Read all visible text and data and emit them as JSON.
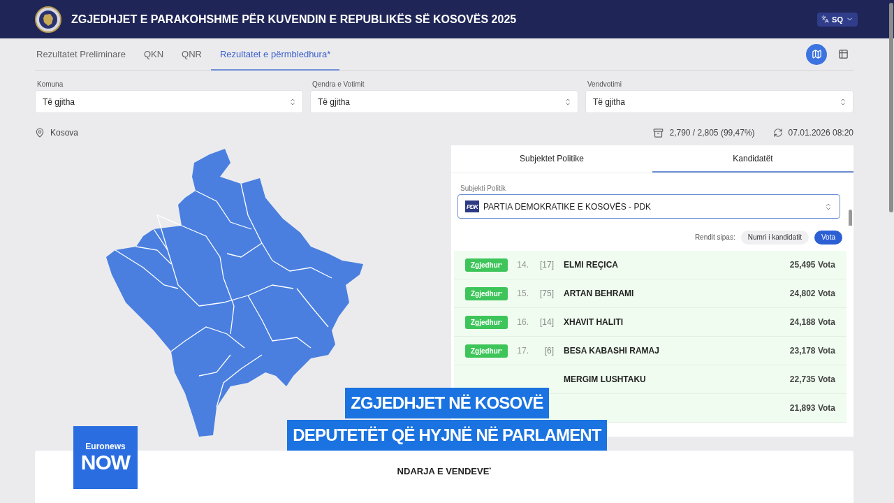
{
  "header": {
    "title": "ZGJEDHJET E PARAKOHSHME PËR KUVENDIN E REPUBLIKËS SË KOSOVËS 2025",
    "language": "SQ"
  },
  "tabs": [
    {
      "label": "Rezultatet Preliminare",
      "selected": false
    },
    {
      "label": "QKN",
      "selected": false
    },
    {
      "label": "QNR",
      "selected": false
    },
    {
      "label": "Rezultatet e përmbledhura*",
      "selected": true
    }
  ],
  "view_toggle": [
    {
      "kind": "map",
      "selected": true
    },
    {
      "kind": "table",
      "selected": false
    }
  ],
  "filters": [
    {
      "label": "Komuna",
      "value": "Të gjitha"
    },
    {
      "label": "Qendra e Votimit",
      "value": "Të gjitha"
    },
    {
      "label": "Vendvotimi",
      "value": "Të gjitha"
    }
  ],
  "location": "Kosova",
  "stations": "2,790 / 2,805 (99,47%)",
  "updated": "07.01.2026 08:20",
  "panel": {
    "tabs": [
      {
        "label": "Subjektet Politike",
        "selected": false
      },
      {
        "label": "Kandidatët",
        "selected": true
      }
    ],
    "party_label": "Subjekti Politik",
    "party_logo": "PDK",
    "party": "PARTIA DEMOKRATIKE E KOSOVËS - PDK",
    "sort_label": "Rendit sipas:",
    "sort_options": [
      {
        "label": "Numri i kandidatit",
        "selected": false
      },
      {
        "label": "Vota",
        "selected": true
      }
    ],
    "candidates": [
      {
        "status": "Zgjedhur$^{*}$",
        "rank": "14.",
        "number": "[17]",
        "name": "ELMI REÇICA",
        "votes": "25,495 Vota"
      },
      {
        "status": "Zgjedhur$^{*}$",
        "rank": "15.",
        "number": "[75]",
        "name": "ARTAN BEHRAMI",
        "votes": "24,802 Vota"
      },
      {
        "status": "Zgjedhur$^{*}$",
        "rank": "16.",
        "number": "[14]",
        "name": "XHAVIT HALITI",
        "votes": "24,188 Vota"
      },
      {
        "status": "Zgjedhur$^{*}$",
        "rank": "17.",
        "number": "[6]",
        "name": "BESA KABASHI RAMAJ",
        "votes": "23,178 Vota"
      },
      {
        "name": "MERGIM LUSHTAKU",
        "votes": "22,735 Vota"
      },
      {
        "votes": "21,893 Vota"
      }
    ]
  },
  "section_title": "NDARJA E VENDEVE$^{*}$",
  "lower_third": [
    "ZGJEDHJET NË KOSOVË",
    "DEPUTETËT QË HYJNË NË PARLAMENT"
  ],
  "channel_logo": {
    "top": "Euronews",
    "bottom": "NOW"
  }
}
